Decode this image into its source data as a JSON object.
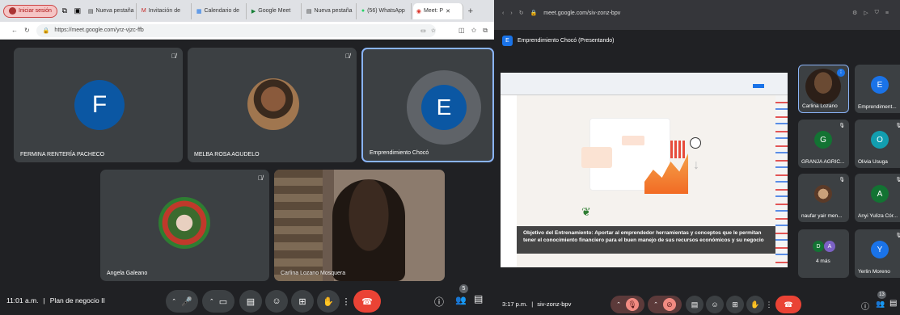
{
  "left": {
    "browser": {
      "signin_label": "Iniciar sesión",
      "tabs": [
        {
          "label": "Nueva pestaña"
        },
        {
          "label": "Invitación de"
        },
        {
          "label": "Calendario de"
        },
        {
          "label": "Google Meet"
        },
        {
          "label": "Nueva pestaña"
        },
        {
          "label": "(56) WhatsApp"
        },
        {
          "label": "Meet: P"
        }
      ],
      "url": "https://meet.google.com/yrz-vjzc-ffb",
      "new_tab": "+",
      "close": "✕"
    },
    "tiles": [
      {
        "name": "FERMINA RENTERÍA PACHECO",
        "initial": "F",
        "color": "#0b57a3"
      },
      {
        "name": "MELBA ROSA AGUDELO"
      },
      {
        "name": "Emprendimiento Chocó",
        "initial": "E",
        "color": "#0b57a3"
      },
      {
        "name": "Angela Galeano"
      },
      {
        "name": "Carlina Lozano Mosquera"
      }
    ],
    "bottom": {
      "time": "11:01 a.m.",
      "meeting": "Plan de negocio II",
      "participants_badge": "5"
    }
  },
  "right": {
    "browser": {
      "url": "meet.google.com/siv-zonz-bpv"
    },
    "presenting": {
      "avatar_letter": "E",
      "label": "Emprendimiento Chocó (Presentando)"
    },
    "slide": {
      "text": "Objetivo del Entrenamiento: Aportar al emprendedor herramientas y conceptos que le permitan tener el conocimiento financiero para el buen manejo de sus recursos económicos y su negocio"
    },
    "tiles": [
      {
        "name": "Carlina Lozano"
      },
      {
        "name": "Emprendiment...",
        "initial": "E",
        "color": "#1a73e8"
      },
      {
        "name": "GRANJA AGRIC...",
        "initial": "G",
        "color": "#137333"
      },
      {
        "name": "Olivia Usuga",
        "initial": "O",
        "color": "#129eaf"
      },
      {
        "name": "naufar yair men..."
      },
      {
        "name": "Anyi Yuliza Cór...",
        "initial": "A",
        "color": "#137333"
      },
      {
        "name": "4 más",
        "initials": [
          "D",
          "A"
        ]
      },
      {
        "name": "Yerlin Moreno",
        "initial": "Y",
        "color": "#1a73e8"
      }
    ],
    "bottom": {
      "time": "3:17 p.m.",
      "meeting": "siv-zonz-bpv",
      "participants_badge": "13"
    }
  }
}
